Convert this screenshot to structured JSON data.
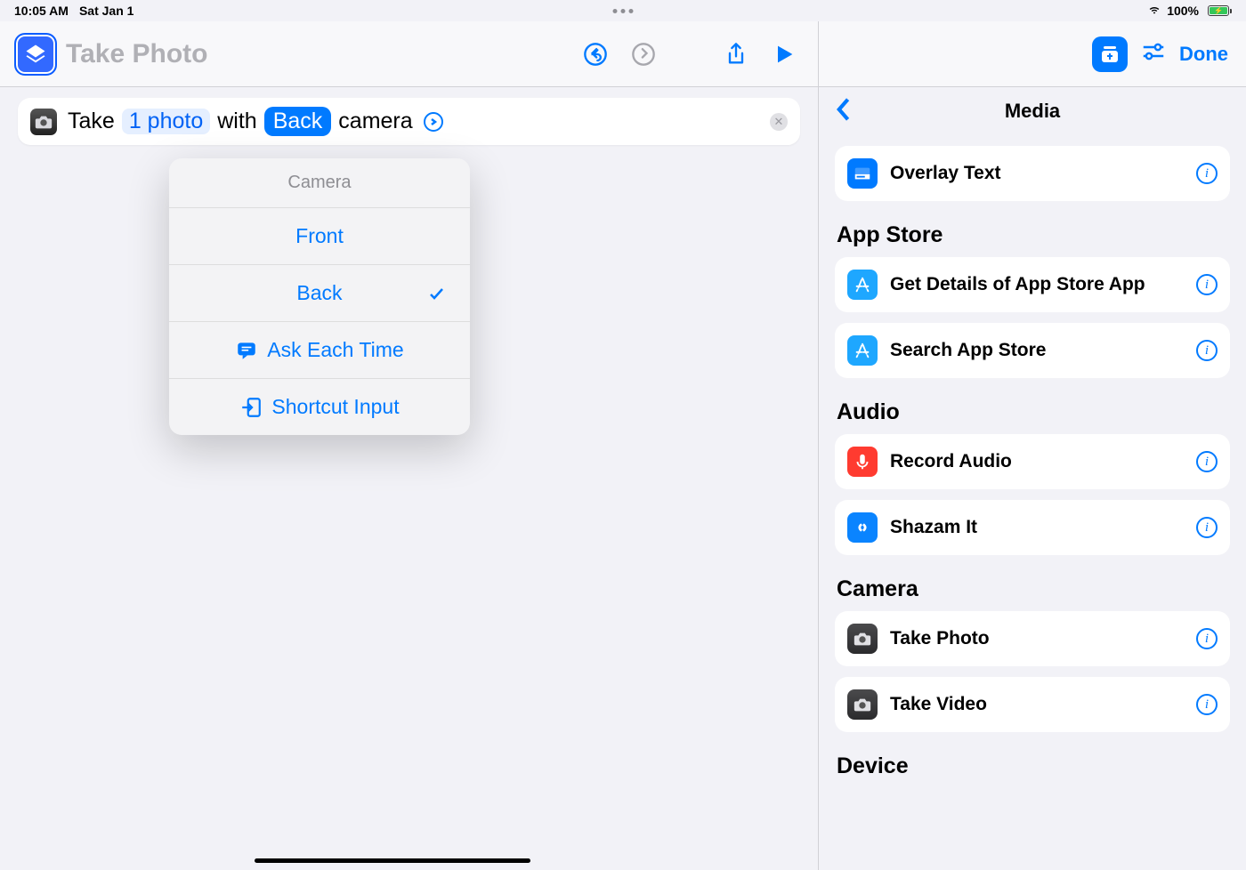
{
  "status": {
    "time": "10:05 AM",
    "date": "Sat Jan 1",
    "battery_pct": "100%"
  },
  "toolbar": {
    "title": "Take Photo"
  },
  "action": {
    "prefix": "Take",
    "count_param": "1 photo",
    "mid": "with",
    "camera_param": "Back",
    "suffix": "camera"
  },
  "popover": {
    "header": "Camera",
    "options": [
      "Front",
      "Back"
    ],
    "selected": "Back",
    "ask": "Ask Each Time",
    "input": "Shortcut Input"
  },
  "side": {
    "done": "Done",
    "back_title": "Media",
    "sections": [
      {
        "title": "",
        "items": [
          {
            "label": "Overlay Text",
            "icon": "overlay",
            "color": "icon-blue"
          }
        ]
      },
      {
        "title": "App Store",
        "items": [
          {
            "label": "Get Details of App Store App",
            "icon": "appstore",
            "color": "icon-lightblue"
          },
          {
            "label": "Search App Store",
            "icon": "appstore",
            "color": "icon-lightblue"
          }
        ]
      },
      {
        "title": "Audio",
        "items": [
          {
            "label": "Record Audio",
            "icon": "mic",
            "color": "icon-red"
          },
          {
            "label": "Shazam It",
            "icon": "shazam",
            "color": "icon-shazam"
          }
        ]
      },
      {
        "title": "Camera",
        "items": [
          {
            "label": "Take Photo",
            "icon": "camera",
            "color": "icon-dark"
          },
          {
            "label": "Take Video",
            "icon": "camera",
            "color": "icon-dark"
          }
        ]
      },
      {
        "title": "Device",
        "items": []
      }
    ]
  }
}
